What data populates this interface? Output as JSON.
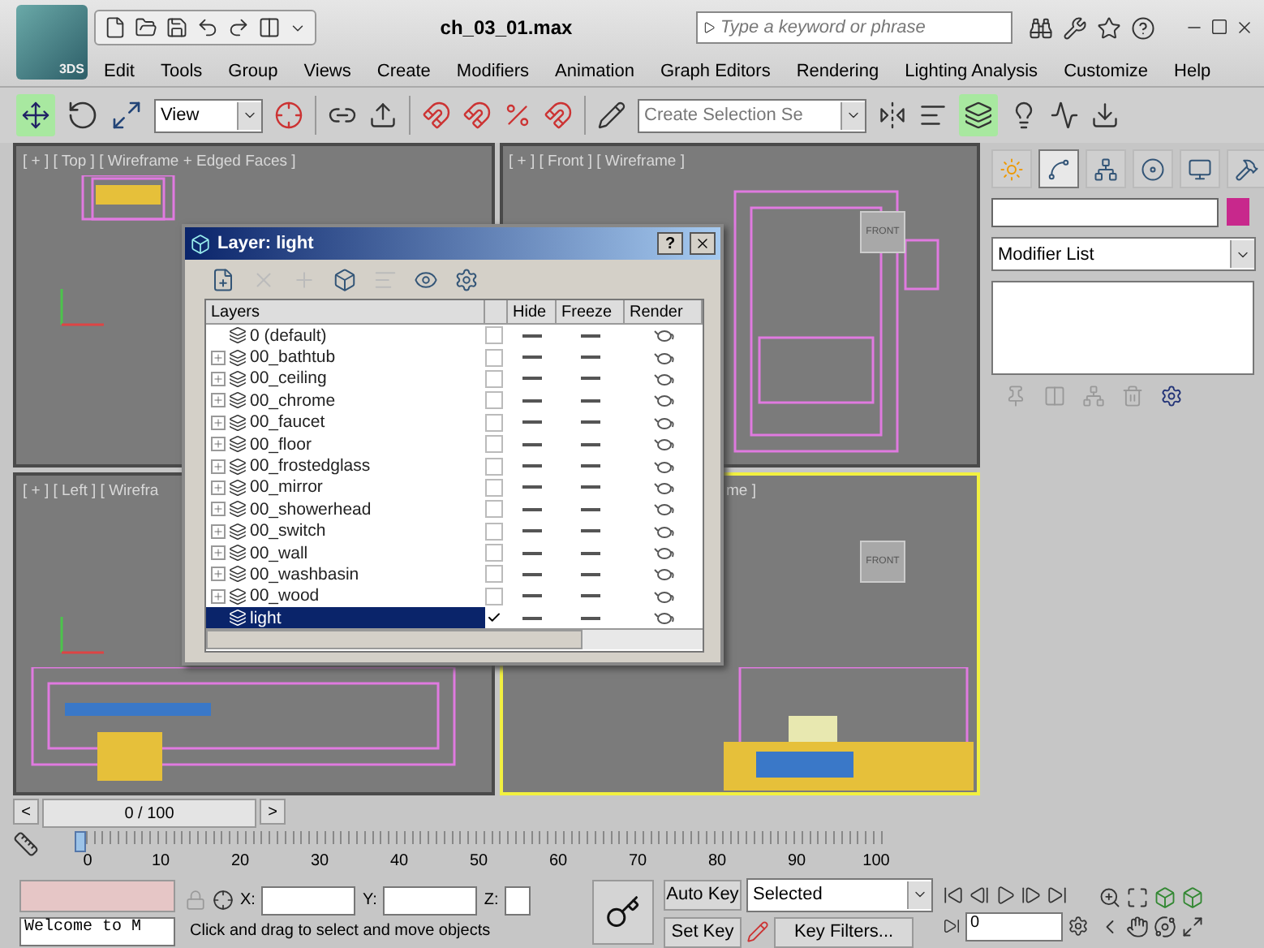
{
  "title_bar": {
    "app_badge": "3DS",
    "title": "ch_03_01.max",
    "search": {
      "placeholder": "Type a keyword or phrase"
    }
  },
  "menu": [
    "Edit",
    "Tools",
    "Group",
    "Views",
    "Create",
    "Modifiers",
    "Animation",
    "Graph Editors",
    "Rendering",
    "Lighting Analysis",
    "Customize",
    "Help"
  ],
  "toolbar": {
    "reference_coordinate": "View",
    "selection_set": {
      "placeholder": "Create Selection Se"
    }
  },
  "viewports": [
    {
      "label": "[ + ] [ Top ] [ Wireframe + Edged Faces ]",
      "active": false
    },
    {
      "label": "[ + ] [ Front ] [ Wireframe ]",
      "active": false,
      "viewcube": "FRONT"
    },
    {
      "label": "[ + ] [ Left ] [ Wirefra",
      "active": false
    },
    {
      "label": "me ]",
      "active": true,
      "viewcube": "FRONT"
    }
  ],
  "layer_dialog": {
    "title": "Layer: light",
    "help": "?",
    "columns": [
      {
        "label": "Layers"
      },
      {
        "label": "Hide"
      },
      {
        "label": "Freeze"
      },
      {
        "label": "Render"
      }
    ],
    "rows": [
      {
        "name": "0 (default)",
        "has_children": false,
        "selected": false,
        "current": false
      },
      {
        "name": "00_bathtub",
        "has_children": true,
        "selected": false,
        "current": false
      },
      {
        "name": "00_ceiling",
        "has_children": true,
        "selected": false,
        "current": false
      },
      {
        "name": "00_chrome",
        "has_children": true,
        "selected": false,
        "current": false
      },
      {
        "name": "00_faucet",
        "has_children": true,
        "selected": false,
        "current": false
      },
      {
        "name": "00_floor",
        "has_children": true,
        "selected": false,
        "current": false
      },
      {
        "name": "00_frostedglass",
        "has_children": true,
        "selected": false,
        "current": false
      },
      {
        "name": "00_mirror",
        "has_children": true,
        "selected": false,
        "current": false
      },
      {
        "name": "00_showerhead",
        "has_children": true,
        "selected": false,
        "current": false
      },
      {
        "name": "00_switch",
        "has_children": true,
        "selected": false,
        "current": false
      },
      {
        "name": "00_wall",
        "has_children": true,
        "selected": false,
        "current": false
      },
      {
        "name": "00_washbasin",
        "has_children": true,
        "selected": false,
        "current": false
      },
      {
        "name": "00_wood",
        "has_children": true,
        "selected": false,
        "current": false
      },
      {
        "name": "light",
        "has_children": false,
        "selected": true,
        "current": true
      }
    ]
  },
  "command_panel": {
    "tabs": [
      {
        "selected": false
      },
      {
        "selected": true
      },
      {
        "selected": false
      },
      {
        "selected": false
      },
      {
        "selected": false
      },
      {
        "selected": false
      }
    ],
    "modifier_list": "Modifier List"
  },
  "timeline": {
    "level": 0,
    "prev": "<",
    "position": "0 / 100",
    "next": ">",
    "ticks": [
      "0",
      "10",
      "20",
      "30",
      "40",
      "50",
      "60",
      "70",
      "80",
      "90",
      "100"
    ]
  },
  "status": {
    "listener": "Welcome to M",
    "prompt": "Click and drag to select and move objects",
    "coords": [
      {
        "label": "X:"
      },
      {
        "label": "Y:"
      },
      {
        "label": "Z:"
      }
    ],
    "auto_key": "Auto Key",
    "set_key": "Set Key",
    "key_mode": "Selected",
    "key_filters": "Key Filters...",
    "current_frame": "0"
  }
}
